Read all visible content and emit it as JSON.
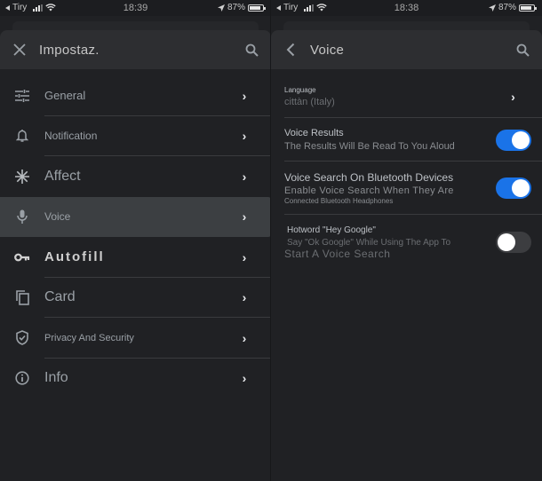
{
  "left_screen": {
    "status_bar": {
      "carrier": "Tiry",
      "time": "18:39",
      "battery": "87%",
      "battery_level": 0.87
    },
    "app_bar": {
      "lead_icon": "close-icon",
      "title": "Impostaz.",
      "trail_icon": "search-icon"
    },
    "menu": [
      {
        "label": "General",
        "icon": "tune-sliders-icon",
        "active": false
      },
      {
        "label": "Notification",
        "icon": "bell-icon",
        "active": false
      },
      {
        "label": "Affect",
        "icon": "asterisk-icon",
        "active": false
      },
      {
        "label": "Voice",
        "icon": "microphone-icon",
        "active": true
      },
      {
        "label": "Autofill",
        "icon": "key-icon",
        "active": false
      },
      {
        "label": "Card",
        "icon": "copy-card-icon",
        "active": false
      },
      {
        "label": "Privacy And Security",
        "icon": "shield-check-icon",
        "active": false
      },
      {
        "label": "Info",
        "icon": "info-icon",
        "active": false
      }
    ]
  },
  "right_screen": {
    "status_bar": {
      "carrier": "Tiry",
      "time": "18:38",
      "battery": "87%",
      "battery_level": 0.87
    },
    "app_bar": {
      "lead_icon": "back-arrow-icon",
      "title": "Voice",
      "trail_icon": "search-icon"
    },
    "settings": [
      {
        "title": "Language",
        "subtitle": "cittàn (Italy)",
        "control": "chevron"
      },
      {
        "title": "Voice Results",
        "subtitle": "The Results Will Be Read To You Aloud",
        "control": "toggle",
        "enabled": true
      },
      {
        "title": "Voice Search On Bluetooth Devices",
        "subtitle": "Enable Voice Search When They Are",
        "subtitle2": "Connected Bluetooth Headphones",
        "control": "toggle",
        "enabled": true
      },
      {
        "title": "Hotword \"Hey Google\"",
        "subtitle": "Say \"Ok Google\" While Using The App To",
        "subtitle2": "Start A Voice Search",
        "control": "toggle",
        "enabled": false
      }
    ]
  },
  "colors": {
    "background": "#202124",
    "app_bar": "#2d2e31",
    "active_row": "#3c3f42",
    "toggle_on": "#1a73e8",
    "toggle_off": "#3c3d40"
  }
}
